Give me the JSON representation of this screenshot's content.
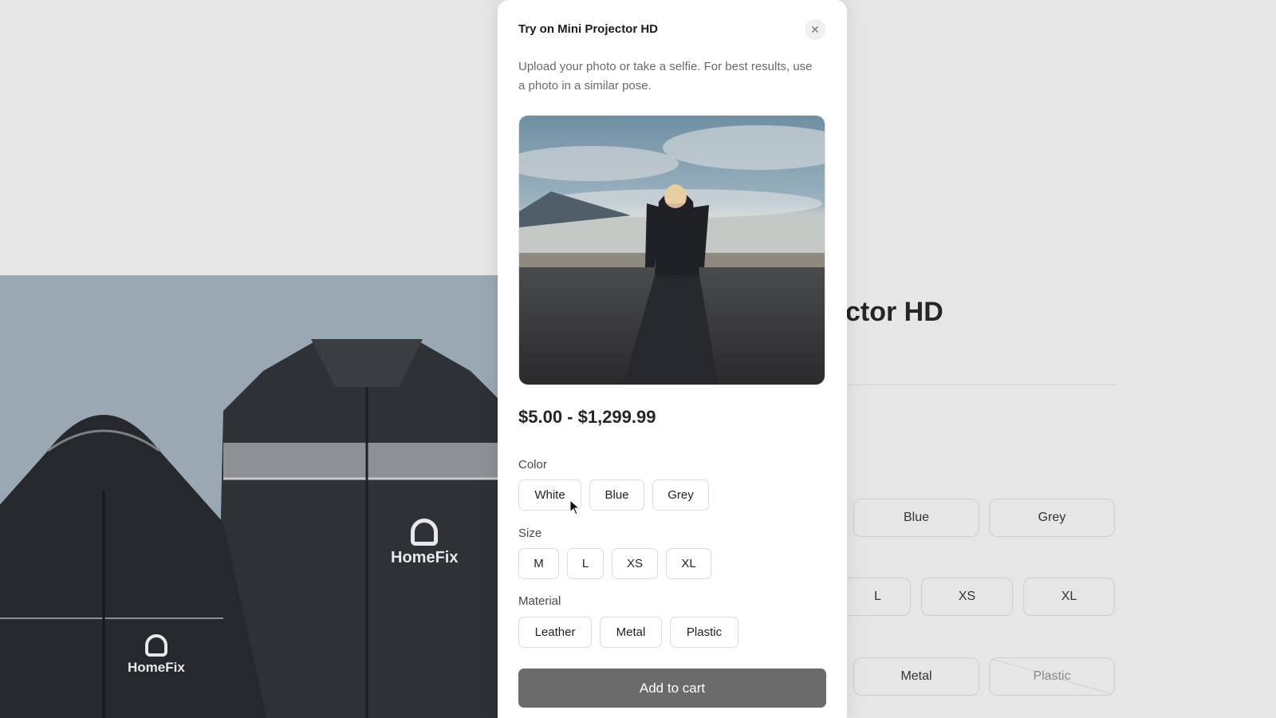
{
  "background": {
    "title_fragment": "ctor HD",
    "brand_logo_text": "HomeFix",
    "options": {
      "color": [
        "Blue",
        "Grey"
      ],
      "size": [
        "L",
        "XS",
        "XL"
      ],
      "material": [
        "Metal",
        "Plastic"
      ]
    }
  },
  "modal": {
    "title": "Try on Mini Projector HD",
    "description": "Upload your photo or take a selfie. For best results, use a photo in a similar pose.",
    "close_icon": "close-icon",
    "price": "$5.00 - $1,299.99",
    "color_label": "Color",
    "colors": [
      "White",
      "Blue",
      "Grey"
    ],
    "size_label": "Size",
    "sizes": [
      "M",
      "L",
      "XS",
      "XL"
    ],
    "material_label": "Material",
    "materials": [
      "Leather",
      "Metal",
      "Plastic"
    ],
    "add_to_cart": "Add to cart"
  },
  "colors": {
    "accent_button": "#6b6b6b",
    "page_background": "#e6e6e6"
  }
}
